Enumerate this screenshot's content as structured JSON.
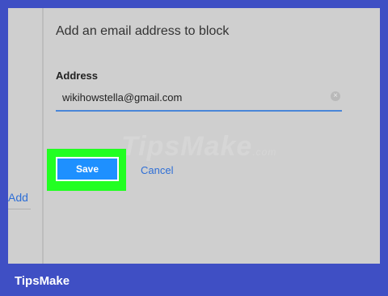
{
  "dialog": {
    "heading": "Add an email address to block",
    "address_label": "Address",
    "address_value": "wikihowstella@gmail.com",
    "clear_symbol": "×",
    "save_label": "Save",
    "cancel_label": "Cancel"
  },
  "sidebar": {
    "add_label": "Add"
  },
  "watermark": {
    "text": "TipsMake",
    "tld": ".com"
  },
  "footer": {
    "brand": "TipsMake"
  },
  "colors": {
    "accent": "#1e90ff",
    "highlight": "#22ff22",
    "frame": "#3f4fc4"
  }
}
